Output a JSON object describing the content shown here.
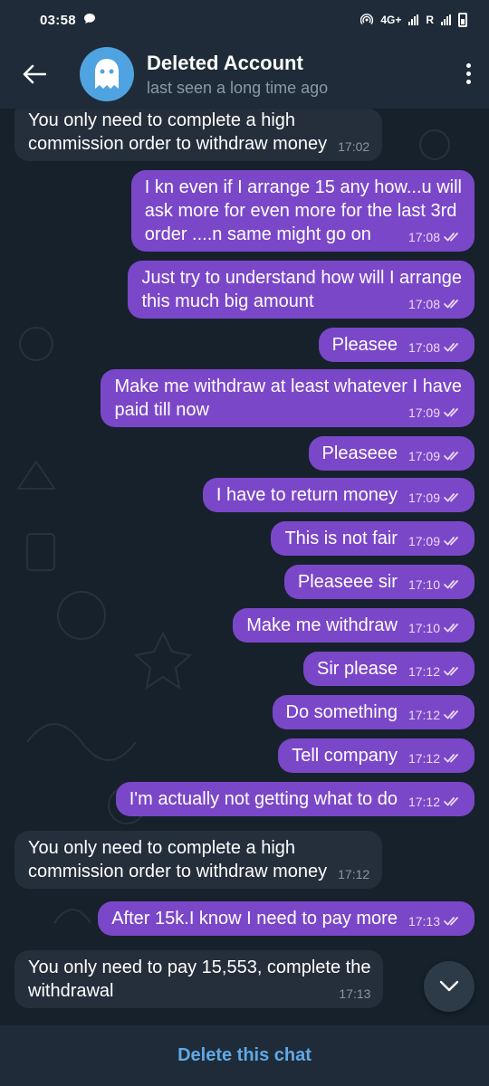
{
  "status_bar": {
    "time": "03:58",
    "network_label": "4G+",
    "roaming_label": "R"
  },
  "header": {
    "title": "Deleted Account",
    "subtitle": "last seen a long time ago",
    "avatar_icon": "ghost-icon",
    "avatar_color": "#4fa3e0"
  },
  "messages": [
    {
      "dir": "in",
      "text": "You only need to complete a high\ncommission order to withdraw money",
      "time": "17:02"
    },
    {
      "dir": "out",
      "text": "I kn even if I arrange 15 any how...u will\nask more for even more for the last 3rd\norder ....n same might go on",
      "time": "17:08"
    },
    {
      "dir": "out",
      "text": "Just try to understand how will I arrange\nthis much big amount",
      "time": "17:08"
    },
    {
      "dir": "out",
      "text": "Pleasee",
      "time": "17:08"
    },
    {
      "dir": "out",
      "text": "Make me withdraw at least whatever I have\npaid till now",
      "time": "17:09"
    },
    {
      "dir": "out",
      "text": "Pleaseee",
      "time": "17:09"
    },
    {
      "dir": "out",
      "text": "I have to return money",
      "time": "17:09"
    },
    {
      "dir": "out",
      "text": "This is not fair",
      "time": "17:09"
    },
    {
      "dir": "out",
      "text": "Pleaseee sir",
      "time": "17:10"
    },
    {
      "dir": "out",
      "text": "Make me withdraw",
      "time": "17:10"
    },
    {
      "dir": "out",
      "text": "Sir please",
      "time": "17:12"
    },
    {
      "dir": "out",
      "text": "Do something",
      "time": "17:12"
    },
    {
      "dir": "out",
      "text": "Tell company",
      "time": "17:12"
    },
    {
      "dir": "out",
      "text": "I'm actually not getting what to do",
      "time": "17:12"
    },
    {
      "dir": "in",
      "text": "You only need to complete a high\ncommission order to withdraw money",
      "time": "17:12"
    },
    {
      "dir": "out",
      "text": "After 15k.I know I need to pay more",
      "time": "17:13"
    },
    {
      "dir": "in",
      "text": "You only need to pay 15,553, complete the\nwithdrawal",
      "time": "17:13"
    }
  ],
  "bottom": {
    "delete_label": "Delete this chat"
  },
  "colors": {
    "outgoing_bubble": "#7b47c9",
    "incoming_bubble": "#252f3b",
    "accent": "#5fa9e6"
  }
}
